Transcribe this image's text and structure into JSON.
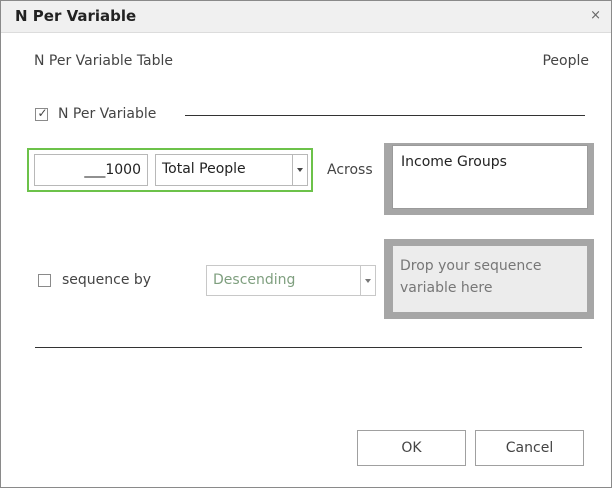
{
  "window": {
    "title": "N Per Variable",
    "close_glyph": "×"
  },
  "header": {
    "table_label": "N Per Variable Table",
    "entity_label": "People"
  },
  "n_per": {
    "checkbox_label": "N Per Variable",
    "checked": true,
    "count_value": "___1000",
    "unit_selected": "Total People",
    "across_label": "Across",
    "across_variable": "Income Groups"
  },
  "sequence": {
    "checkbox_label": "sequence by",
    "checked": false,
    "order_selected": "Descending",
    "drop_placeholder": "Drop your sequence variable here"
  },
  "buttons": {
    "ok": "OK",
    "cancel": "Cancel"
  },
  "colors": {
    "highlight": "#6cc24a",
    "dropzone_border": "#a6a6a6",
    "disabled_text": "#7f9f7f"
  }
}
